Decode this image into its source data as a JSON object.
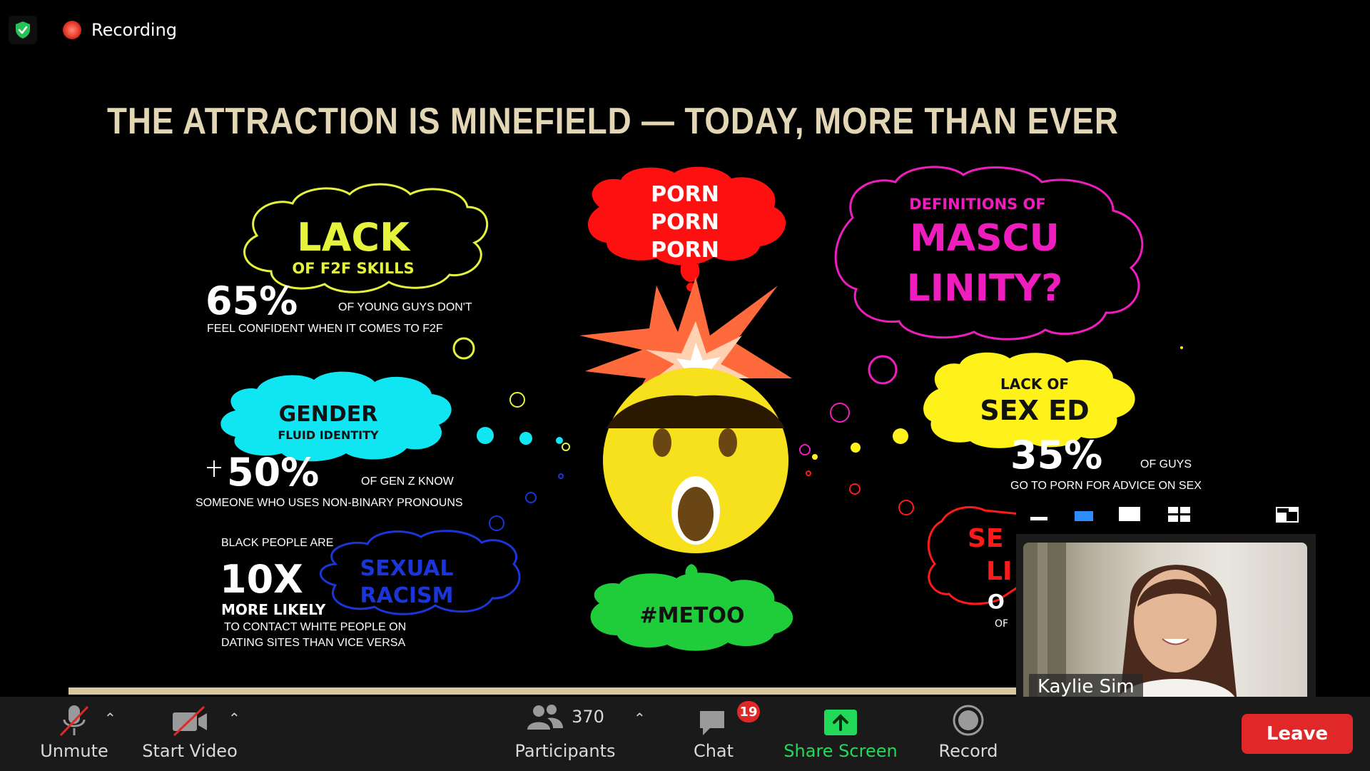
{
  "meeting": {
    "recording_label": "Recording"
  },
  "slide": {
    "title": "THE ATTRACTION IS MINEFIELD — TODAY, MORE THAN EVER",
    "lack": {
      "heading": "LACK",
      "sub": "OF F2F SKILLS",
      "stat": "65%",
      "desc1": "OF YOUNG GUYS DON'T",
      "desc2": "FEEL CONFIDENT WHEN IT COMES TO F2F"
    },
    "gender": {
      "heading": "GENDER",
      "sub": "FLUID IDENTITY",
      "plus": "+",
      "stat": "50%",
      "desc1": "OF GEN Z KNOW",
      "desc2": "SOMEONE WHO USES NON-BINARY PRONOUNS"
    },
    "racism": {
      "intro": "BLACK PEOPLE ARE",
      "stat": "10X",
      "more": "MORE LIKELY",
      "desc1": "TO CONTACT WHITE PEOPLE ON",
      "desc2": "DATING SITES THAN VICE VERSA",
      "bubble1": "SEXUAL",
      "bubble2": "RACISM"
    },
    "porn": {
      "line1": "PORN",
      "line2": "PORN",
      "line3": "PORN"
    },
    "metoo": "#METOO",
    "masculinity": {
      "intro": "DEFINITIONS OF",
      "line1": "MASCU",
      "line2": "LINITY?"
    },
    "sexed": {
      "intro": "LACK OF",
      "heading": "SEX ED",
      "stat": "35%",
      "desc1": "OF GUYS",
      "desc2": "GO TO PORN FOR ADVICE ON SEX"
    },
    "partial": {
      "line1": "SE",
      "line2": "LI",
      "line3": "O",
      "line4": "OF"
    }
  },
  "video": {
    "participant_name": "Kaylie Sim"
  },
  "toolbar": {
    "unmute_label": "Unmute",
    "start_video_label": "Start Video",
    "participants_label": "Participants",
    "participants_count": "370",
    "chat_label": "Chat",
    "chat_badge": "19",
    "share_label": "Share Screen",
    "record_label": "Record",
    "leave_label": "Leave"
  },
  "colors": {
    "share_green": "#23d959",
    "leave_red": "#e02828",
    "title_beige": "#e3d6b4"
  }
}
